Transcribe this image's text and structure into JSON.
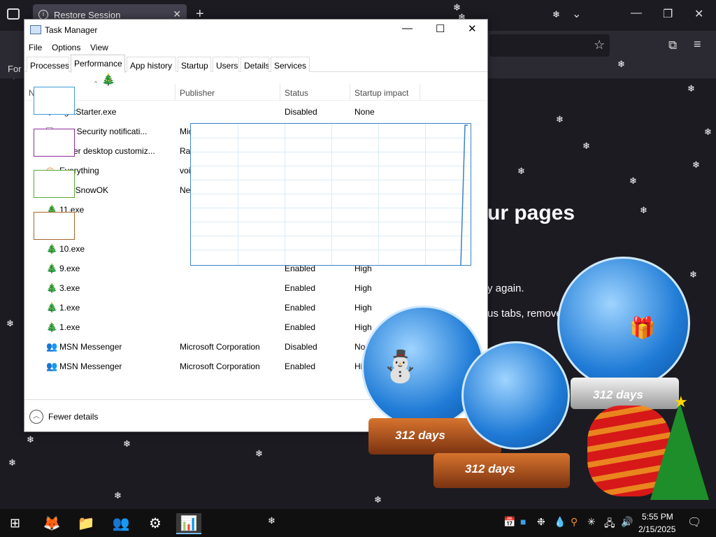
{
  "browser": {
    "tab_title": "Restore Session",
    "tab_icon": "i",
    "new_tab_label": "+",
    "close_tab_label": "✕",
    "bookmark_text": "For",
    "page_heading": "ur pages",
    "page_line1": "y again.",
    "page_line2": "us tabs, remove"
  },
  "task_manager": {
    "title": "Task Manager",
    "menu": [
      "File",
      "Options",
      "View"
    ],
    "tabs": [
      "Processes",
      "Performance",
      "App history",
      "Startup",
      "Users",
      "Details",
      "Services"
    ],
    "active_tab": "Performance",
    "columns": {
      "name": "N",
      "publisher": "Publisher",
      "status": "Status",
      "impact": "Startup impact"
    },
    "rows": [
      {
        "icon": "gadget-icon",
        "name": "dgetStarter.exe",
        "publisher": "",
        "status": "Disabled",
        "impact": "None"
      },
      {
        "icon": "shield-icon",
        "name": "ows Security notificati...",
        "publisher": "Mic",
        "status": "",
        "impact": ""
      },
      {
        "icon": "rainmeter-icon",
        "name": "meter desktop customiz...",
        "publisher": "Rai",
        "status": "",
        "impact": ""
      },
      {
        "icon": "everything-icon",
        "name": "Everything",
        "publisher": "voi",
        "status": "",
        "impact": ""
      },
      {
        "icon": "snow-icon",
        "name": "ktopSnowOK",
        "publisher": "Ne",
        "status": "",
        "impact": ""
      },
      {
        "icon": "tree-icon",
        "name": "11.exe",
        "publisher": "",
        "status": "",
        "impact": ""
      },
      {
        "icon": "tree-icon",
        "name": "xe",
        "publisher": "",
        "status": "",
        "impact": ""
      },
      {
        "icon": "tree-icon",
        "name": "10.exe",
        "publisher": "",
        "status": "",
        "impact": ""
      },
      {
        "icon": "tree-icon",
        "name": "9.exe",
        "publisher": "",
        "status": "Enabled",
        "impact": "High"
      },
      {
        "icon": "tree-icon",
        "name": "3.exe",
        "publisher": "",
        "status": "Enabled",
        "impact": "High"
      },
      {
        "icon": "tree-icon",
        "name": "1.exe",
        "publisher": "",
        "status": "Enabled",
        "impact": "High"
      },
      {
        "icon": "tree-icon",
        "name": "1.exe",
        "publisher": "",
        "status": "Enabled",
        "impact": "High"
      },
      {
        "icon": "msn-icon",
        "name": "MSN Messenger",
        "publisher": "Microsoft Corporation",
        "status": "Disabled",
        "impact": "Non"
      },
      {
        "icon": "msn-icon",
        "name": "MSN Messenger",
        "publisher": "Microsoft Corporation",
        "status": "Enabled",
        "impact": "Hi"
      }
    ],
    "fewer_details": "Fewer details"
  },
  "globes": {
    "label_left": "312 days",
    "label_middle": "312 days",
    "label_right": "312 days"
  },
  "taskbar": {
    "time": "5:55 PM",
    "date": "2/15/2025"
  },
  "colors": {
    "browser_bg": "#1c1b22",
    "taskbar_bg": "#101010",
    "graph_border": "#3b82c4"
  }
}
